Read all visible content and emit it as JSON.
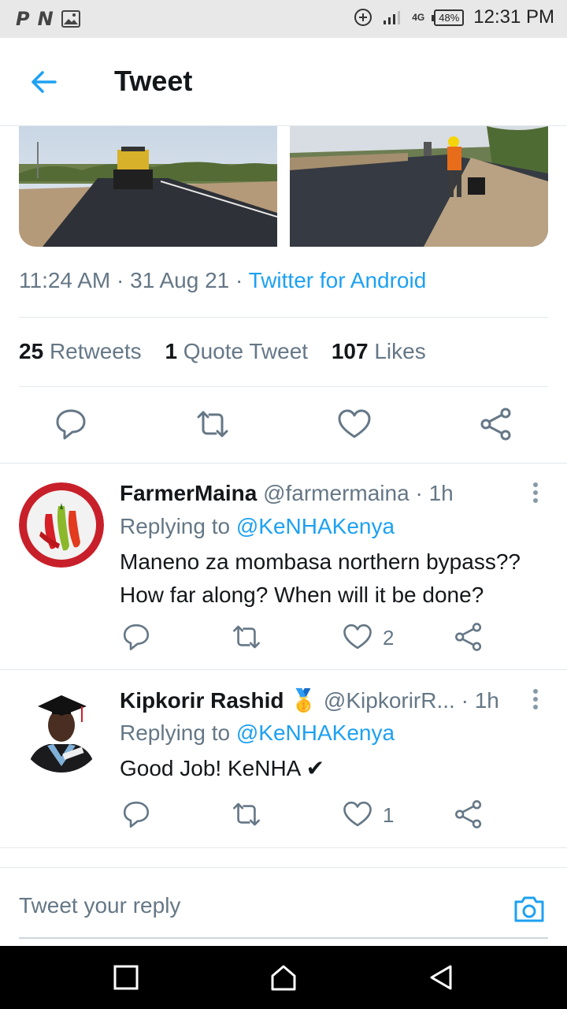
{
  "status_bar": {
    "left_icons": [
      "P",
      "N"
    ],
    "image_icon": "image-icon",
    "network": "4G",
    "battery": "48%",
    "time": "12:31 PM"
  },
  "header": {
    "title": "Tweet",
    "back_icon": "arrow-left-icon"
  },
  "tweet": {
    "time": "11:24 AM",
    "date": "31 Aug 21",
    "source": "Twitter for Android",
    "retweets_count": "25",
    "retweets_label": "Retweets",
    "quote_count": "1",
    "quote_label": "Quote Tweet",
    "likes_count": "107",
    "likes_label": "Likes"
  },
  "replies": [
    {
      "name": "FarmerMaina",
      "handle": "@farmermaina",
      "time": "1h",
      "replying_label": "Replying to",
      "replying_to": "@KeNHAKenya",
      "text": "Maneno za mombasa northern bypass?? How far along? When will it be done?",
      "likes": "2"
    },
    {
      "name": "Kipkorir Rashid",
      "badge": "🥇",
      "handle": "@KipkorirR...",
      "time": "1h",
      "replying_label": "Replying to",
      "replying_to": "@KeNHAKenya",
      "text": "Good Job! KeNHA ✔",
      "likes": "1"
    }
  ],
  "reply_box": {
    "placeholder": "Tweet your reply"
  },
  "colors": {
    "accent": "#1da1f2",
    "secondary_text": "#657786",
    "primary_text": "#14171a"
  }
}
